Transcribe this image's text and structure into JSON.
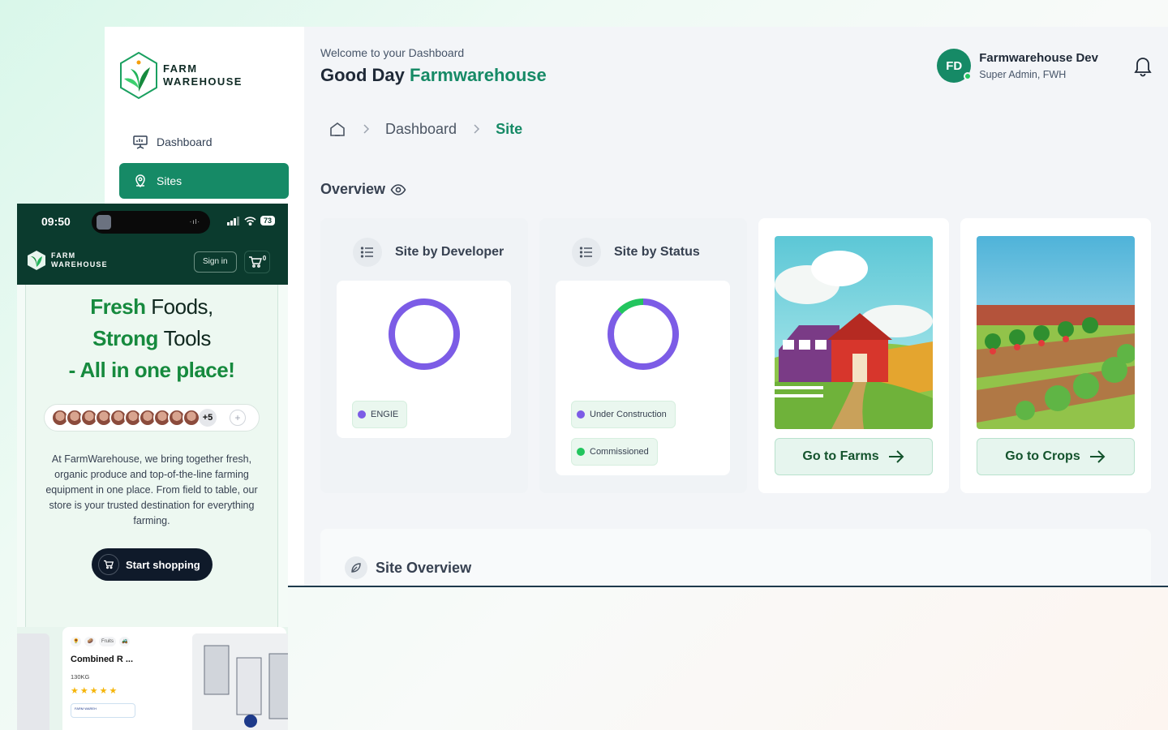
{
  "brand": {
    "line1": "FARM",
    "line2": "WAREHOUSE",
    "accent": "#168a66",
    "dark": "#0b3b2e"
  },
  "sidebar": {
    "items": [
      {
        "label": "Dashboard",
        "icon": "presentation-icon",
        "active": false
      },
      {
        "label": "Sites",
        "icon": "map-pin-icon",
        "active": true
      }
    ]
  },
  "header": {
    "welcome": "Welcome to your Dashboard",
    "greeting_prefix": "Good Day",
    "greeting_name": "Farmwarehouse",
    "user": {
      "initials": "FD",
      "name": "Farmwarehouse Dev",
      "role": "Super Admin, FWH"
    }
  },
  "breadcrumb": {
    "items": [
      "Dashboard"
    ],
    "current": "Site"
  },
  "overview": {
    "title": "Overview",
    "cards": [
      {
        "title": "Site by Developer",
        "chart_data": {
          "type": "pie",
          "categories": [
            "ENGIE"
          ],
          "values": [
            100
          ],
          "colors": [
            "#7c5ce6"
          ]
        },
        "legend": [
          {
            "label": "ENGIE",
            "color": "#7c5ce6"
          }
        ]
      },
      {
        "title": "Site by Status",
        "chart_data": {
          "type": "pie",
          "categories": [
            "Under Construction",
            "Commissioned"
          ],
          "values": [
            87,
            13
          ],
          "colors": [
            "#7c5ce6",
            "#22c55e"
          ]
        },
        "legend": [
          {
            "label": "Under Construction",
            "color": "#7c5ce6"
          },
          {
            "label": "Commissioned",
            "color": "#22c55e"
          }
        ]
      }
    ],
    "links": [
      {
        "label": "Go to Farms",
        "image": "barn-illustration"
      },
      {
        "label": "Go to Crops",
        "image": "crops-illustration"
      }
    ]
  },
  "site_overview": {
    "title": "Site Overview"
  },
  "mobile": {
    "time": "09:50",
    "battery": "73",
    "sign_in": "Sign in",
    "cart_count": "0",
    "hero": {
      "line1_green": "Fresh",
      "line1_dark": "Foods,",
      "line2_green": "Strong",
      "line2_dark": "Tools",
      "line3": "- All in one place!"
    },
    "avatar_extra": "+5",
    "add_label": "+",
    "description": "At FarmWarehouse, we bring together fresh, organic produce and top-of-the-line farming equipment in one place. From field to table, our store is your trusted destination for everything farming.",
    "cta": "Start shopping",
    "product": {
      "tag": "Fruits",
      "name": "Combined R ...",
      "weight": "130KG",
      "stars": "★★★★★",
      "seller": "FARM WAREH"
    }
  }
}
